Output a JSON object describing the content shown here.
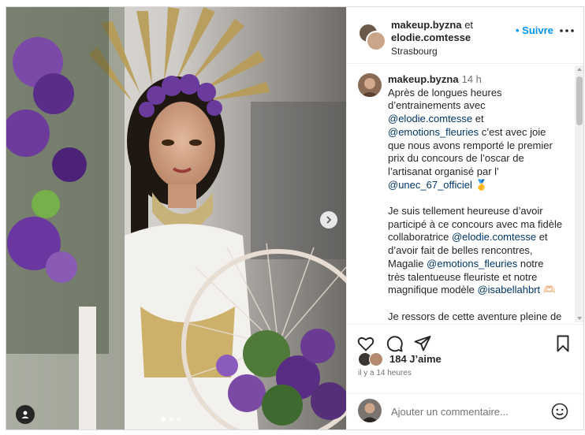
{
  "post": {
    "header": {
      "author": "makeup.byzna",
      "and_text": " et",
      "coauthor": "elodie.comtesse",
      "location": "Strasbourg",
      "follow_label": "• Suivre",
      "more_icon": "more-horizontal-icon"
    },
    "caption": {
      "author": "makeup.byzna",
      "time": "14 h",
      "paragraphs": [
        [
          {
            "t": "Après de longues heures d’entrainements avec "
          },
          {
            "t": "@elodie.comtesse",
            "m": true
          },
          {
            "t": " et "
          },
          {
            "t": "@emotions_fleuries",
            "m": true
          },
          {
            "t": " c’est avec joie que nous avons remporté le premier prix du concours de l’oscar de l’artisanat organisé par l’ "
          },
          {
            "t": "@unec_67_officiel",
            "m": true
          },
          {
            "t": " 🥇"
          }
        ],
        [
          {
            "t": "Je suis tellement heureuse d’avoir participé à ce concours avec ma fidèle collaboratrice "
          },
          {
            "t": "@elodie.comtesse",
            "m": true
          },
          {
            "t": " et d’avoir fait de belles rencontres, Magalie "
          },
          {
            "t": "@emotions_fleuries",
            "m": true
          },
          {
            "t": " notre très talentueuse fleuriste et notre magnifique modèle "
          },
          {
            "t": "@isabellahbrt",
            "m": true
          },
          {
            "t": " 🫶🏻"
          }
        ],
        [
          {
            "t": "Je ressors de cette aventure pleine de ressources et fière de représenter nos"
          }
        ]
      ]
    },
    "likes": "184 J’aime",
    "time_ago": "il y a 14 heures",
    "comment_placeholder": "Ajouter un commentaire...",
    "carousel": {
      "total": 3,
      "active": 0
    },
    "icons": {
      "like": "heart-icon",
      "comment": "comment-icon",
      "share": "share-icon",
      "save": "bookmark-icon",
      "emoji": "smiley-icon",
      "next": "chevron-right-icon",
      "tagged_users": "user-tag-icon"
    },
    "colors": {
      "link": "#00376b",
      "follow": "#0095f6",
      "muted": "#737373"
    }
  }
}
